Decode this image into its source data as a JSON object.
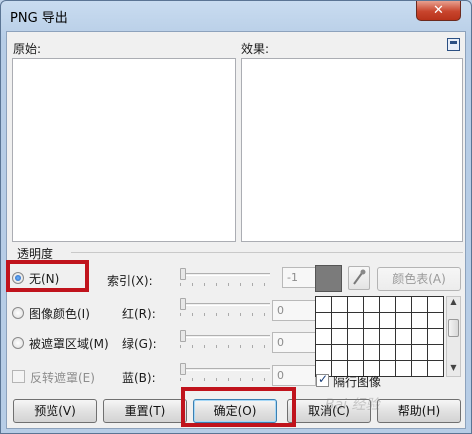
{
  "window": {
    "title": "PNG 导出",
    "close_glyph": "✕"
  },
  "preview": {
    "original_label": "原始:",
    "effect_label": "效果:"
  },
  "transparency": {
    "group_label": "透明度",
    "options": [
      {
        "label": "无(N)",
        "selected": true
      },
      {
        "label": "图像颜色(I)",
        "selected": false
      },
      {
        "label": "被遮罩区域(M)",
        "selected": false
      }
    ],
    "invert_mask_label": "反转遮罩(E)",
    "invert_mask_checked": false
  },
  "channels": {
    "index_label": "索引(X):",
    "red_label": "红(R):",
    "green_label": "绿(G):",
    "blue_label": "蓝(B):",
    "index_value": "-1",
    "red_value": "0",
    "green_value": "0",
    "blue_value": "0"
  },
  "color_swatch": "#7b7b7b",
  "eyedropper_icon": "eyedropper-icon",
  "color_table_button": "颜色表(A)",
  "interlace": {
    "label": "隔行图像",
    "checked": true
  },
  "buttons": {
    "preview": "预览(V)",
    "reset": "重置(T)",
    "ok": "确定(O)",
    "cancel": "取消(C)",
    "help": "帮助(H)"
  },
  "watermark": "Bai 经验"
}
